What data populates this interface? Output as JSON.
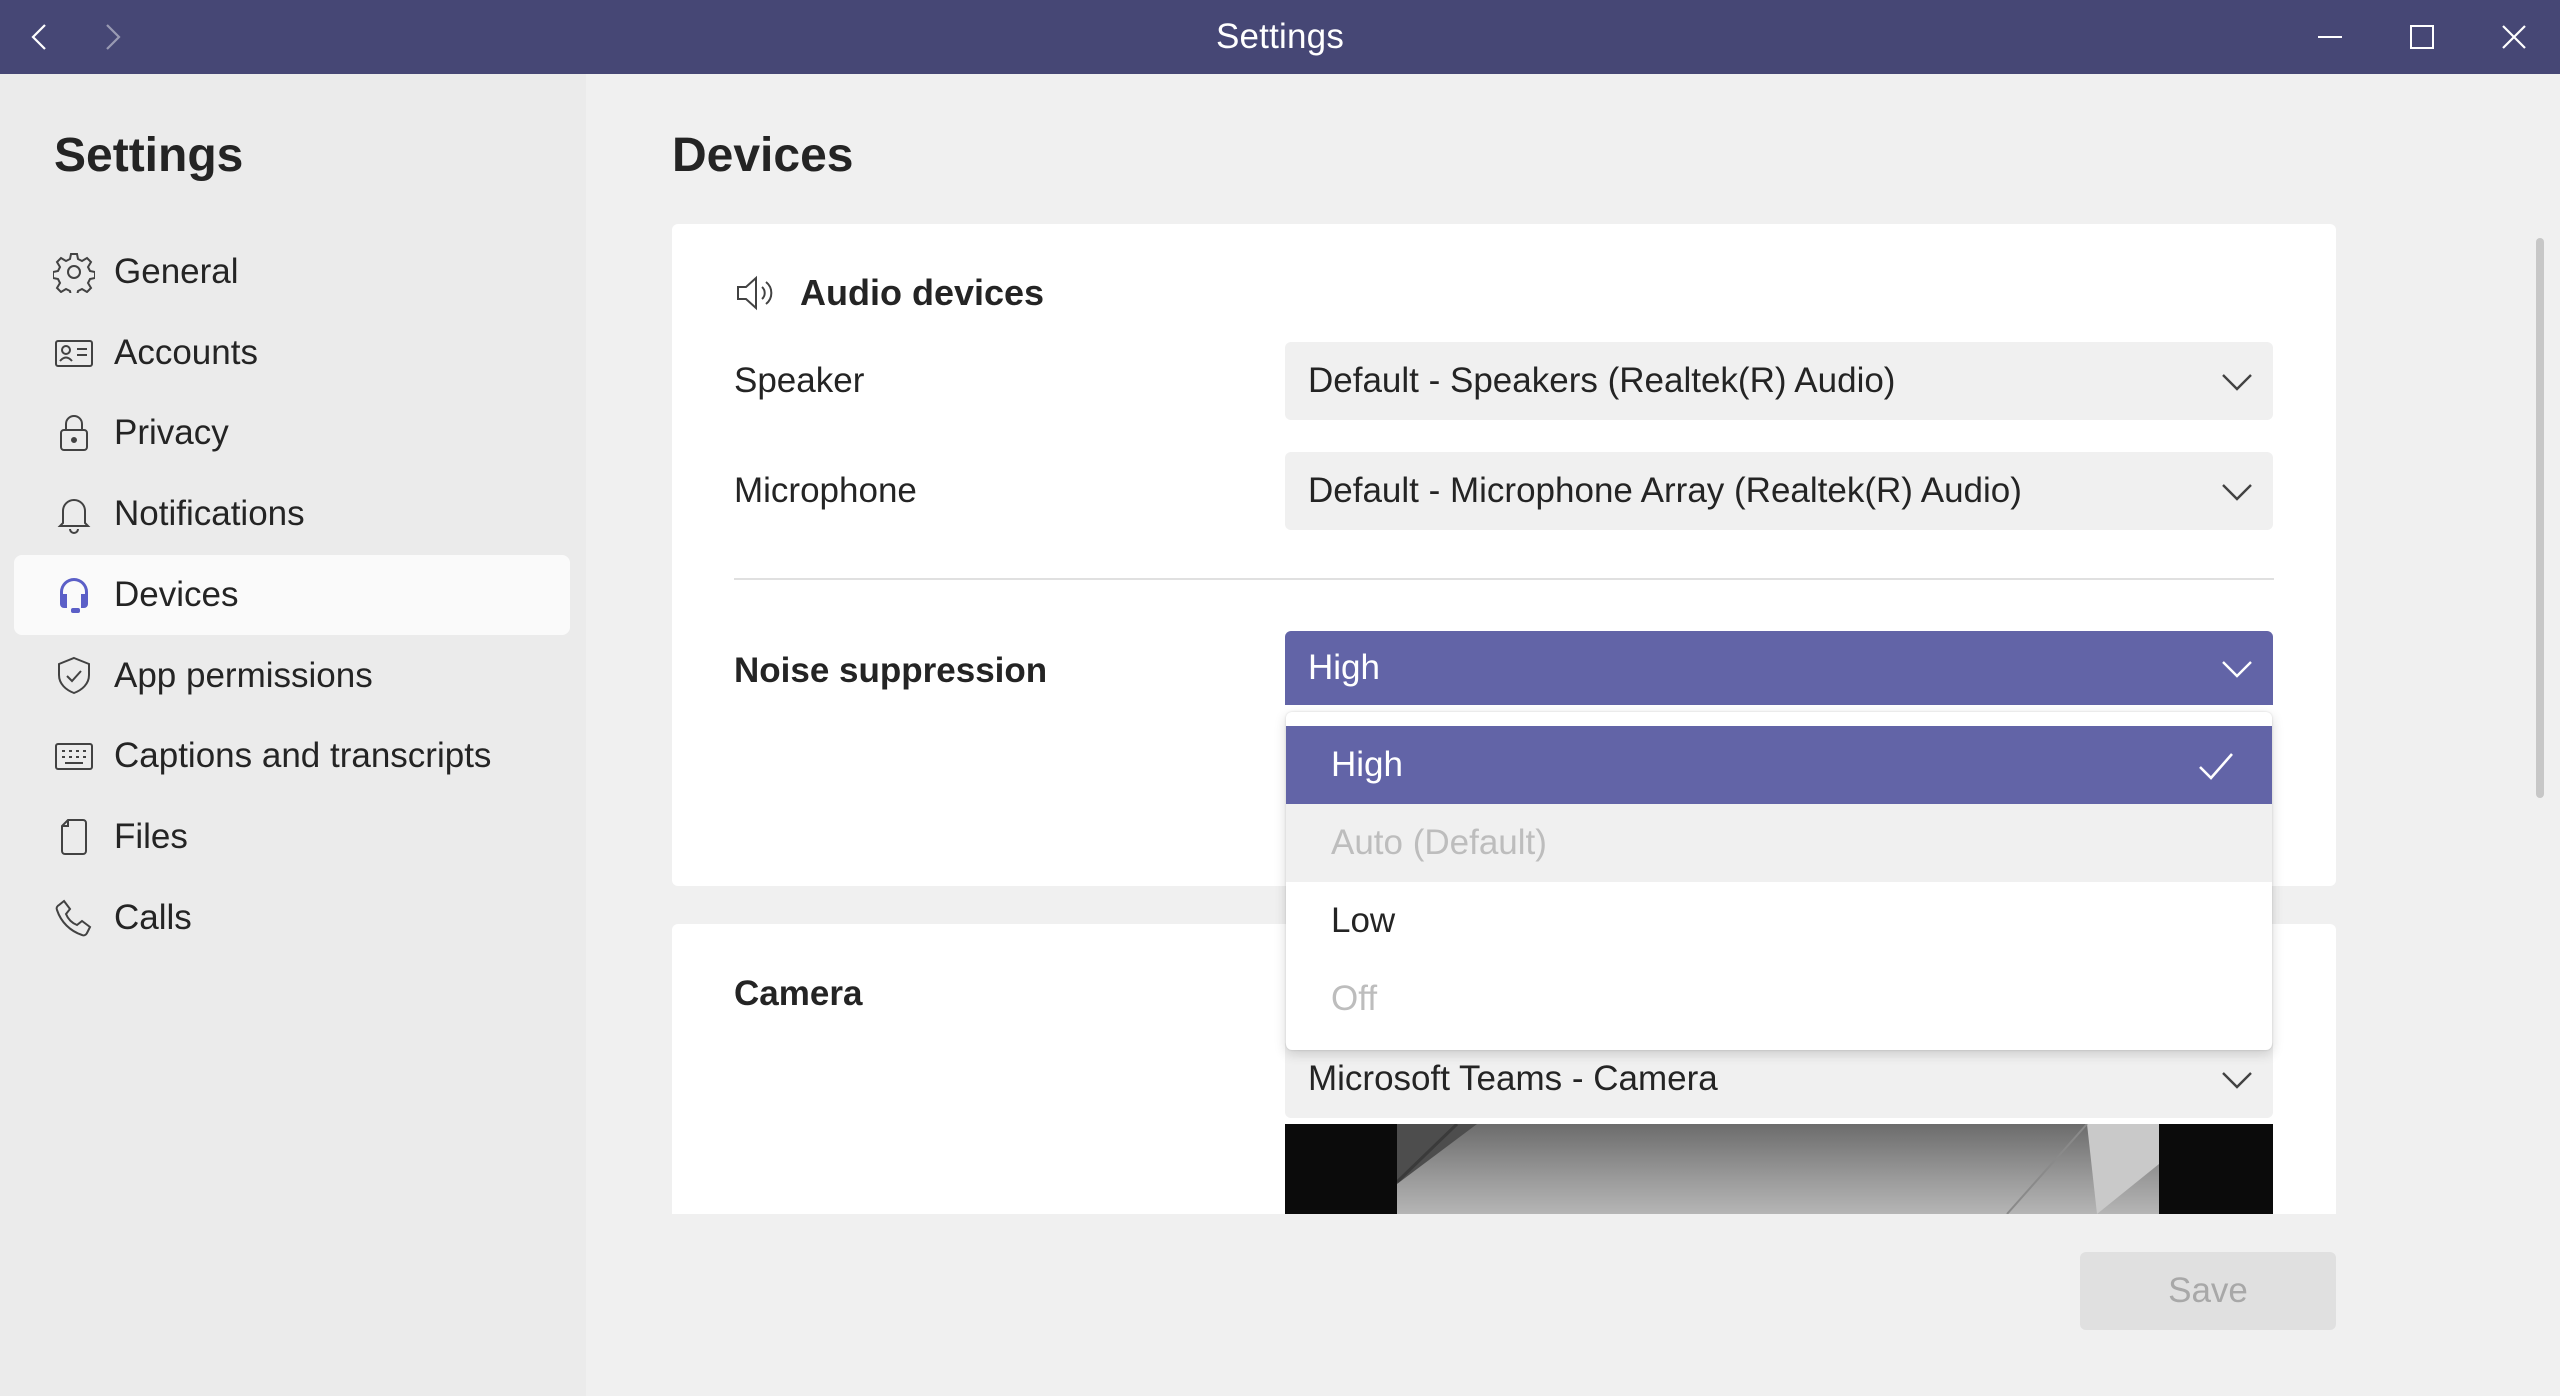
{
  "window": {
    "title": "Settings",
    "back_icon": "chevron-left-icon",
    "forward_icon": "chevron-right-icon",
    "controls": [
      "minimize-icon",
      "maximize-icon",
      "close-icon"
    ]
  },
  "colors": {
    "title_bar": "#464775",
    "accent": "#6264a7",
    "sidebar_bg": "#ebebeb",
    "content_bg": "#f0f0f0",
    "card_bg": "#ffffff"
  },
  "sidebar": {
    "title": "Settings",
    "items": [
      {
        "label": "General",
        "icon": "gear-icon",
        "active": false
      },
      {
        "label": "Accounts",
        "icon": "id-card-icon",
        "active": false
      },
      {
        "label": "Privacy",
        "icon": "lock-icon",
        "active": false
      },
      {
        "label": "Notifications",
        "icon": "bell-icon",
        "active": false
      },
      {
        "label": "Devices",
        "icon": "headset-icon",
        "active": true
      },
      {
        "label": "App permissions",
        "icon": "shield-icon",
        "active": false
      },
      {
        "label": "Captions and transcripts",
        "icon": "keyboard-icon",
        "active": false
      },
      {
        "label": "Files",
        "icon": "file-icon",
        "active": false
      },
      {
        "label": "Calls",
        "icon": "phone-icon",
        "active": false
      }
    ]
  },
  "main": {
    "title": "Devices",
    "audio": {
      "heading": "Audio devices",
      "icon": "speaker-icon",
      "speaker_label": "Speaker",
      "speaker_value": "Default - Speakers (Realtek(R) Audio)",
      "microphone_label": "Microphone",
      "microphone_value": "Default - Microphone Array (Realtek(R) Audio)",
      "noise_label": "Noise suppression",
      "noise_value": "High",
      "noise_options": [
        {
          "label": "High",
          "state": "selected"
        },
        {
          "label": "Auto (Default)",
          "state": "disabled-hover"
        },
        {
          "label": "Low",
          "state": "normal"
        },
        {
          "label": "Off",
          "state": "disabled"
        }
      ]
    },
    "camera": {
      "heading": "Camera",
      "value": "Microsoft Teams - Camera"
    },
    "save_label": "Save"
  }
}
